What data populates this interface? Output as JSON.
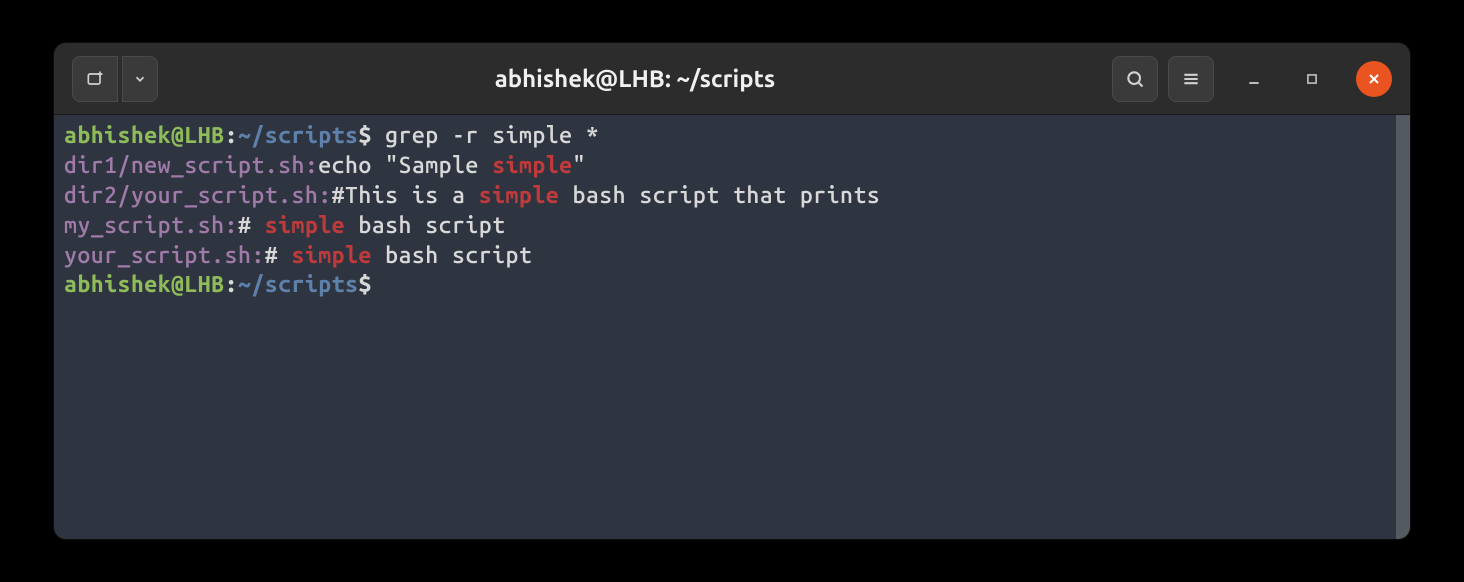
{
  "window": {
    "title": "abhishek@LHB: ~/scripts"
  },
  "prompt": {
    "user_host": "abhishek@LHB",
    "separator": ":",
    "path": "~/scripts",
    "symbol": "$"
  },
  "command": "grep -r simple *",
  "output": [
    {
      "file": "dir1/new_script.sh:",
      "pre": "echo \"Sample ",
      "match": "simple",
      "post": "\""
    },
    {
      "file": "dir2/your_script.sh:",
      "pre": "#This is a ",
      "match": "simple",
      "post": " bash script that prints"
    },
    {
      "file": "my_script.sh:",
      "pre": "# ",
      "match": "simple",
      "post": " bash script"
    },
    {
      "file": "your_script.sh:",
      "pre": "# ",
      "match": "simple",
      "post": " bash script"
    }
  ],
  "colors": {
    "user": "#8fbc5a",
    "path": "#5e81ac",
    "file": "#a07aa8",
    "match": "#bf3b3b",
    "close": "#e95420",
    "bg": "#2e3440"
  }
}
